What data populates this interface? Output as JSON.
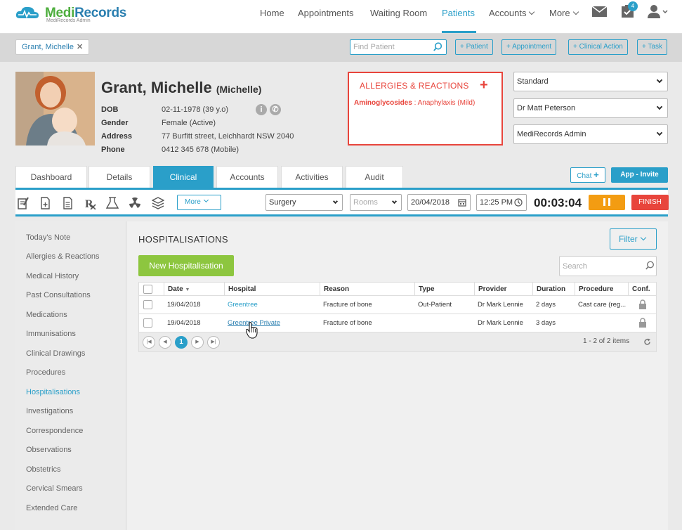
{
  "app": {
    "name_part1": "Medi",
    "name_part2": "Records",
    "subtitle": "MediRecords Admin"
  },
  "nav": {
    "items": [
      "Home",
      "Appointments",
      "Waiting Room",
      "Patients",
      "Accounts",
      "More"
    ],
    "active": "Patients",
    "tasks_badge": "4"
  },
  "patient_bar": {
    "open_patient_tab": "Grant, Michelle",
    "find_placeholder": "Find Patient",
    "buttons": [
      "+ Patient",
      "+ Appointment",
      "+ Clinical Action",
      "+ Task"
    ]
  },
  "patient": {
    "name": "Grant, Michelle",
    "preferred_name": "(Michelle)",
    "fields": [
      {
        "label": "DOB",
        "value": "02-11-1978 (39 y.o)"
      },
      {
        "label": "Gender",
        "value": "Female (Active)"
      },
      {
        "label": "Address",
        "value": "77 Burfitt street, Leichhardt NSW 2040"
      },
      {
        "label": "Phone",
        "value": "0412 345 678 (Mobile)"
      }
    ]
  },
  "allergies": {
    "title": "ALLERGIES & REACTIONS",
    "add_label": "+",
    "items": [
      {
        "substance": "Aminoglycosides",
        "reaction": " : Anaphylaxis (Mild)"
      }
    ]
  },
  "selectors": {
    "appointment_type": "Standard",
    "practitioner": "Dr Matt Peterson",
    "location": "MediRecords Admin"
  },
  "tabs": [
    "Dashboard",
    "Details",
    "Clinical",
    "Accounts",
    "Activities",
    "Audit"
  ],
  "active_tab": "Clinical",
  "chat_label": "Chat",
  "app_invite_label": "App - Invite",
  "toolbar": {
    "more_label": "More",
    "setting": "Surgery",
    "rooms": "Rooms",
    "date": "20/04/2018",
    "time": "12:25 PM",
    "timer": "00:03:04",
    "finish_label": "FINISH"
  },
  "sidebar": {
    "items": [
      "Today's Note",
      "Allergies & Reactions",
      "Medical History",
      "Past Consultations",
      "Medications",
      "Immunisations",
      "Clinical Drawings",
      "Procedures",
      "Hospitalisations",
      "Investigations",
      "Correspondence",
      "Observations",
      "Obstetrics",
      "Cervical Smears",
      "Extended Care"
    ],
    "active": "Hospitalisations"
  },
  "main": {
    "title": "HOSPITALISATIONS",
    "filter_label": "Filter",
    "new_button": "New Hospitalisation",
    "search_placeholder": "Search"
  },
  "table": {
    "columns": [
      "Date",
      "Hospital",
      "Reason",
      "Type",
      "Provider",
      "Duration",
      "Procedure",
      "Conf."
    ],
    "sort_indicator": "▼",
    "rows": [
      {
        "date": "19/04/2018",
        "hospital": "Greentree",
        "reason": "Fracture of bone",
        "type": "Out-Patient",
        "provider": "Dr Mark Lennie",
        "duration": "2 days",
        "procedure": "Cast care (reg..."
      },
      {
        "date": "19/04/2018",
        "hospital": "Greentree Private",
        "reason": "Fracture of bone",
        "type": "",
        "provider": "Dr Mark Lennie",
        "duration": "3 days",
        "procedure": ""
      }
    ]
  },
  "pager": {
    "current_page": "1",
    "info": "1 - 2 of 2 items"
  },
  "colors": {
    "accent": "#2a9fc9",
    "brand_green": "#4eae3e",
    "allergy_red": "#e8453c",
    "pause_orange": "#f39c12",
    "new_green": "#8dc63f"
  }
}
